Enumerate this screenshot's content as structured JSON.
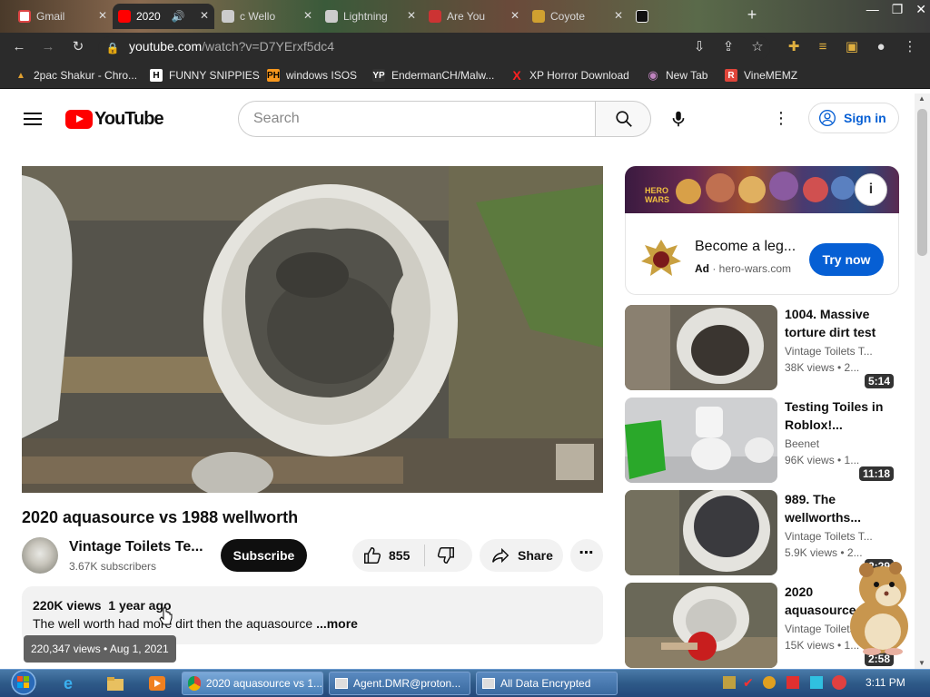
{
  "browser": {
    "tabs": [
      {
        "label": "Gmail",
        "fav_color": "#ffffff"
      },
      {
        "label": "2020",
        "fav_color": "#ff0000",
        "active": true
      },
      {
        "label": "c Wello",
        "fav_color": "#cccccc"
      },
      {
        "label": "Lightning",
        "fav_color": "#cccccc"
      },
      {
        "label": "Are You",
        "fav_color": "#cc3333"
      },
      {
        "label": "Coyote",
        "fav_color": "#d0a030"
      },
      {
        "label": "",
        "fav_color": "#111111"
      }
    ],
    "new_tab": "+",
    "window_controls": {
      "minimize": "—",
      "restore": "❐",
      "close": "✕"
    },
    "url": {
      "host": "youtube.com",
      "path": "/watch?v=D7YErxf5dc4"
    },
    "bookmarks": [
      {
        "label": "2pac Shakur - Chro...",
        "icon": "H-icon",
        "icon_text": "▲",
        "color": "#e0a030"
      },
      {
        "label": "FUNNY SNIPPIES",
        "icon_text": "H",
        "color": "#ffffff"
      },
      {
        "label": "windows ISOS",
        "icon_text": "PH",
        "color": "#f7971d"
      },
      {
        "label": "EndermanCH/Malw...",
        "icon_text": "YP",
        "color": "#333333"
      },
      {
        "label": "XP Horror Download",
        "icon_text": "X",
        "color": "#ff2020"
      },
      {
        "label": "New Tab",
        "icon_text": "◉",
        "color": "#c084c0"
      },
      {
        "label": "VineMEMZ",
        "icon_text": "R",
        "color": "#e0453a"
      }
    ]
  },
  "yt": {
    "logo": "YouTube",
    "search_placeholder": "Search",
    "sign_in": "Sign in",
    "video": {
      "title": "2020 aquasource vs 1988 wellworth",
      "channel": "Vintage Toilets Te...",
      "subscribers": "3.67K subscribers",
      "subscribe": "Subscribe",
      "likes": "855",
      "share": "Share",
      "views": "220K views",
      "age": "1 year ago",
      "description": "The well worth had more dirt then the aquasource",
      "more": "...more",
      "tooltip": "220,347 views • Aug 1, 2021"
    },
    "ad": {
      "title": "Become a leg...",
      "label": "Ad",
      "domain": "· hero-wars.com",
      "cta": "Try now",
      "info": "i"
    },
    "recs": [
      {
        "title": "1004. Massive torture dirt test",
        "channel": "Vintage Toilets T...",
        "meta": "38K views • 2...",
        "duration": "5:14"
      },
      {
        "title": "Testing Toiles in Roblox!...",
        "channel": "Beenet",
        "meta": "96K views • 1...",
        "duration": "11:18"
      },
      {
        "title": "989. The wellworths...",
        "channel": "Vintage Toilets T...",
        "meta": "5.9K views • 2...",
        "duration": "2:29"
      },
      {
        "title": "2020 aquasource...",
        "channel": "Vintage Toilets T...",
        "meta": "15K views • 1...",
        "duration": "2:58"
      }
    ]
  },
  "taskbar": {
    "buttons": [
      "2020 aquasource vs 1...",
      "Agent.DMR@proton...",
      "All Data Encrypted"
    ],
    "clock": "3:11 PM"
  },
  "colors": {
    "yt_red": "#ff0000",
    "link_blue": "#065fd4",
    "chrome_dark": "#2b2b2b"
  }
}
